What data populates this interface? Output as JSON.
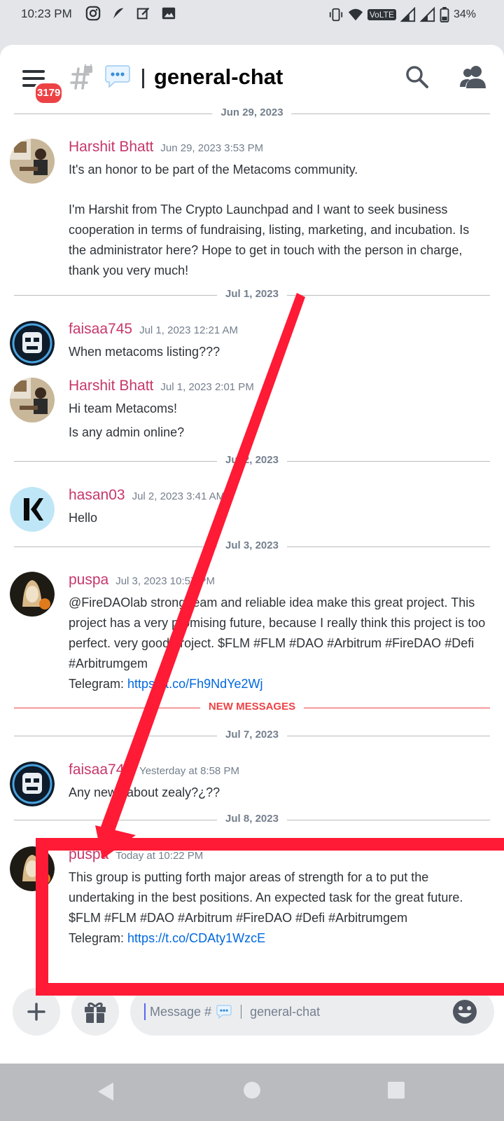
{
  "status_bar": {
    "time": "10:23 PM",
    "network_label": "VoLTE",
    "battery": "34%"
  },
  "header": {
    "channel_name": "general-chat",
    "unread_badge": "3179"
  },
  "messages": [
    {
      "date_separator": "Jun 29, 2023",
      "author": "Harshit Bhatt",
      "timestamp": "Jun 29, 2023 3:53 PM",
      "paragraphs": [
        "It's an honor to be part of the Metacoms community.",
        "I'm Harshit from The Crypto Launchpad and I want to seek business cooperation in terms of fundraising, listing, marketing, and incubation. Is the administrator here? Hope to get in touch with the person in charge, thank you very much!"
      ]
    },
    {
      "date_separator": "Jul 1, 2023",
      "author": "faisaa745",
      "timestamp": "Jul 1, 2023 12:21 AM",
      "paragraphs": [
        "When metacoms listing???"
      ]
    },
    {
      "author": "Harshit Bhatt",
      "timestamp": "Jul 1, 2023 2:01 PM",
      "paragraphs": [
        "Hi team Metacoms!",
        "Is any admin online?"
      ]
    },
    {
      "date_separator": "Jul 2, 2023",
      "author": "hasan03",
      "timestamp": "Jul 2, 2023 3:41 AM",
      "paragraphs": [
        "Hello"
      ]
    },
    {
      "date_separator": "Jul 3, 2023",
      "author": "puspa",
      "timestamp": "Jul 3, 2023 10:57 PM",
      "paragraphs": [
        "@FireDAOlab strong team and reliable idea make this great project. This project has a very promising future, because I really think this project is too perfect. very good project. $FLM #FLM #DAO #Arbitrum #FireDAO #Defi #Arbitrumgem"
      ],
      "telegram_label": "Telegram: ",
      "telegram_link": "https://t.co/Fh9NdYe2Wj"
    },
    {
      "new_messages_label": "NEW MESSAGES",
      "date_separator": "Jul 7, 2023",
      "author": "faisaa745",
      "timestamp": "Yesterday at 8:58 PM",
      "paragraphs": [
        "Any news about zealy?¿??"
      ]
    },
    {
      "date_separator": "Jul 8, 2023",
      "author": "puspa",
      "timestamp": "Today at 10:22 PM",
      "paragraphs": [
        "This group is putting forth major areas of strength for a to put the undertaking in the best positions. An expected task for the great future. $FLM #FLM #DAO #Arbitrum #FireDAO #Defi #Arbitrumgem"
      ],
      "telegram_label": "Telegram: ",
      "telegram_link": "https://t.co/CDAty1WzcE"
    }
  ],
  "composer": {
    "placeholder_prefix": "Message #",
    "placeholder_channel": "general-chat"
  },
  "colors": {
    "author": "#c6376a",
    "link": "#0068e0",
    "annotation": "#ff1a35",
    "new_messages": "#ed4245"
  }
}
